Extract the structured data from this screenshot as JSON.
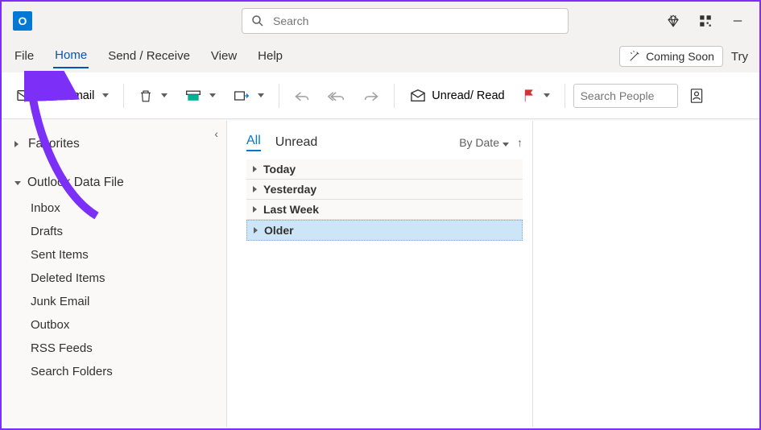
{
  "titlebar": {
    "search_placeholder": "Search"
  },
  "menubar": {
    "tabs": [
      "File",
      "Home",
      "Send / Receive",
      "View",
      "Help"
    ],
    "active_index": 1,
    "coming_soon_label": "Coming Soon",
    "try_label": "Try"
  },
  "ribbon": {
    "new_email_label": "New Email",
    "unread_read_label": "Unread/ Read",
    "search_people_placeholder": "Search People"
  },
  "nav": {
    "favorites_label": "Favorites",
    "datafile_label": "Outlook Data File",
    "folders": [
      "Inbox",
      "Drafts",
      "Sent Items",
      "Deleted Items",
      "Junk Email",
      "Outbox",
      "RSS Feeds",
      "Search Folders"
    ]
  },
  "list": {
    "filter_tabs": [
      "All",
      "Unread"
    ],
    "filter_active": 0,
    "sort_label": "By Date",
    "groups": [
      "Today",
      "Yesterday",
      "Last Week",
      "Older"
    ],
    "selected_index": 3
  }
}
